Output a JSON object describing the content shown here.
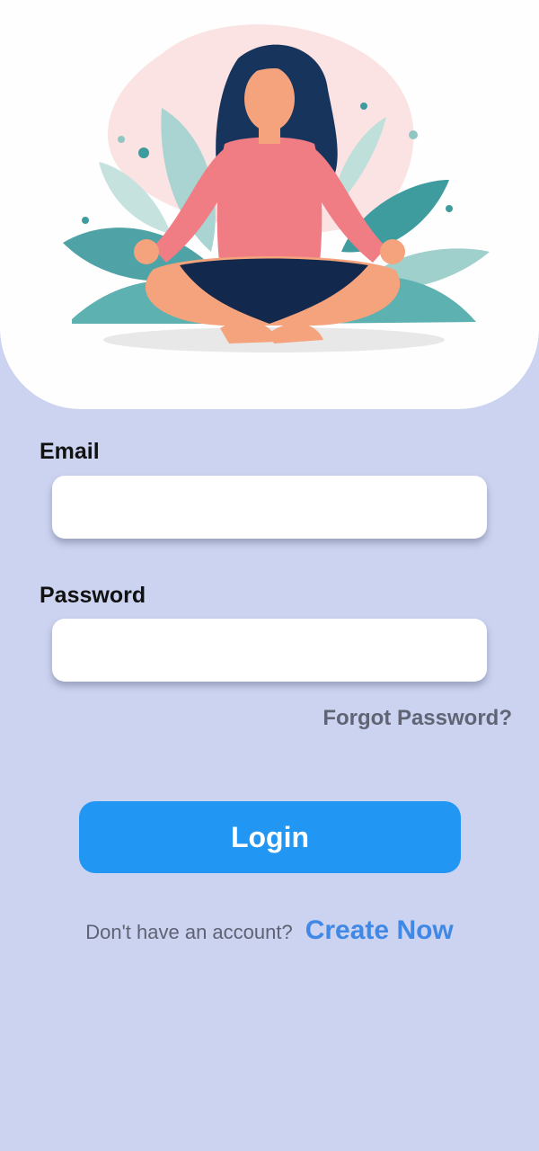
{
  "hero": {
    "illustration": "woman-meditating-lotus-pose"
  },
  "form": {
    "email_label": "Email",
    "email_value": "",
    "password_label": "Password",
    "password_value": "",
    "forgot_label": "Forgot Password?",
    "login_label": "Login"
  },
  "signup": {
    "prompt": "Don't have an account?",
    "link": "Create Now"
  },
  "colors": {
    "background": "#CBD3F0",
    "hero_bg": "#FEFEFE",
    "primary": "#2196F3",
    "link": "#3F88E5",
    "muted_text": "#5E6272"
  }
}
